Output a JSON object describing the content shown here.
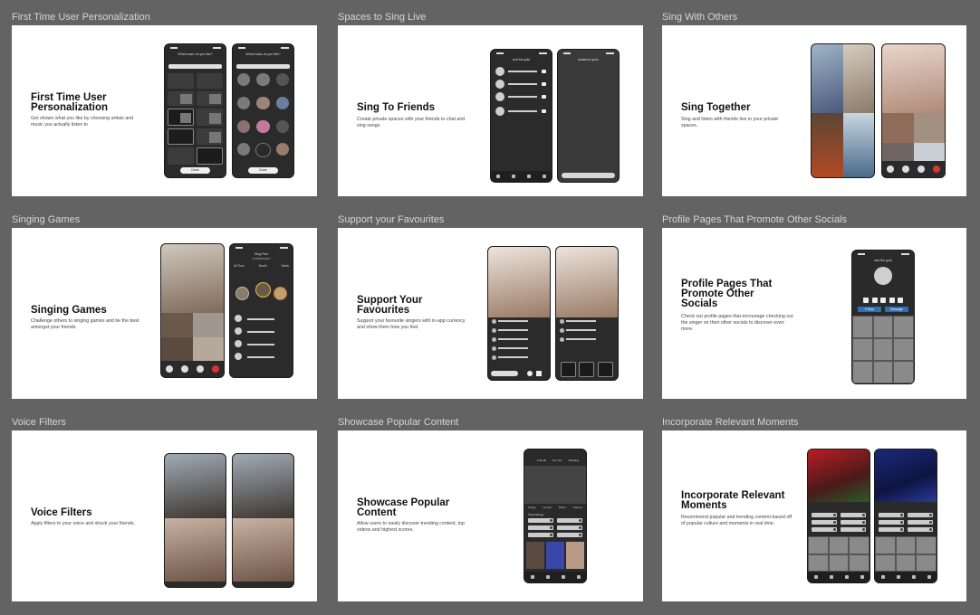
{
  "frames": [
    {
      "label": "First Time User Personalization",
      "title": "First Time User Personalization",
      "desc": "Get shown what you like by choosing artists and music you actually listen to",
      "phone1": {
        "prompt": "What music do you like?",
        "search": "Search",
        "tiles": [
          "Alternative",
          "Latin",
          "Country",
          "Disney",
          "K-pop",
          "Classics",
          "Vinyl 3"
        ],
        "cta": "Done"
      },
      "phone2": {
        "prompt": "What music do you like?",
        "search": "Search",
        "cta": "Done"
      }
    },
    {
      "label": "Spaces to Sing Live",
      "title": "Sing To Friends",
      "desc": "Create private spaces with your friends to chat and sing songs.",
      "phone1": {
        "header": "and the gold"
      },
      "phone2": {
        "header": "whatever goes"
      }
    },
    {
      "label": "Sing With Others",
      "title": "Sing Together",
      "desc": "Sing and listen with friends live in your private spaces."
    },
    {
      "label": "Singing Games",
      "title": "Singing Games",
      "desc": "Challenge others to singing games and be the best amongst your friends",
      "phone2": {
        "header": "Sing Fest",
        "sub": "Leaderboard",
        "tabs": [
          "All Time",
          "Month",
          "Week"
        ]
      }
    },
    {
      "label": "Support your Favourites",
      "title": "Support Your Favourites",
      "desc": "Support your favourite singers with in-app currency and show them how you feel."
    },
    {
      "label": "Profile Pages That Promote Other Socials",
      "title": "Profile Pages That Promote Other Socials",
      "desc": "Check out profile pages that encourage checking out the singer on their other socials to discover even more.",
      "phone1": {
        "header": "and the gold",
        "buttons": [
          "Follow",
          "Message"
        ]
      }
    },
    {
      "label": "Voice Filters",
      "title": "Voice Filters",
      "desc": "Apply filters to your voice and shock your friends."
    },
    {
      "label": "Showcase Popular Content",
      "title": "Showcase Popular Content",
      "desc": "Allow users to easily discover trending content, top videos and highest scores.",
      "phone1": {
        "tabs": [
          "Friends",
          "For You",
          "Trending"
        ],
        "subtabs": [
          "Songs",
          "Covers",
          "Filters",
          "Dances"
        ],
        "section": "Trend Songs"
      }
    },
    {
      "label": "Incorporate Relevant Moments",
      "title": "Incorporate Relevant Moments",
      "desc": "Recommend popular and trending content based off of popular culture and moments in real time."
    }
  ]
}
